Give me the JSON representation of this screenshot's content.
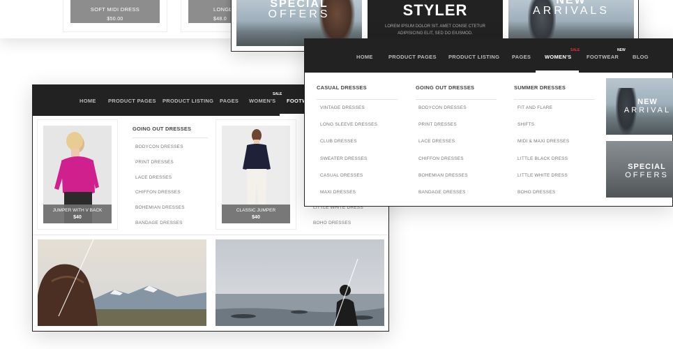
{
  "top_left": {
    "tiles": [
      {
        "name": "SOFT MIDI DRESS",
        "price": "$50.00"
      },
      {
        "name": "LONGLIN",
        "price": "$48.0"
      }
    ]
  },
  "top_right": {
    "special": {
      "line1": "SPECIAL",
      "line2": "OFFERS"
    },
    "styler": {
      "title": "STYLER",
      "text": "LOREM IPSUM DOLOR SIT. AMET CONSE CTETUR ADIPISICING ELIT, SED DO EIUSMOD."
    },
    "arrivals": {
      "line1": "NEW",
      "line2": "ARRIVALS"
    }
  },
  "nav": {
    "items": [
      "HOME",
      "PRODUCT PAGES",
      "PRODUCT LISTING",
      "PAGES",
      "WOMEN'S",
      "FOOTWEAR",
      "BLOG"
    ],
    "left_footwear": "FOOTW",
    "sale_tag": "SALE",
    "new_tag": "NEW"
  },
  "left_screen": {
    "products": [
      {
        "name": "JUMPER WITH V BACK",
        "price": "$40"
      },
      {
        "name": "CLASSIC JUMPER",
        "price": "$40"
      }
    ],
    "column": {
      "heading": "GOING OUT DRESSES",
      "links": [
        "BODYCON DRESSES",
        "PRINT DRESSES",
        "LACE DRESSES",
        "CHIFFON DRESSES",
        "BOHEMIAN DRESSES",
        "BANDAGE DRESSES"
      ]
    },
    "peek_links": [
      "LITTLE WHITE DRESS",
      "BOHO DRESSES"
    ]
  },
  "dropdown": {
    "columns": [
      {
        "heading": "CASUAL DRESSES",
        "links": [
          "VINTAGE DRESSES",
          "LONG SLEEVE DRESSES",
          "CLUB DRESSES",
          "SWEATER DRESSES",
          "CASUAL DRESSES",
          "MAXI DRESSES"
        ]
      },
      {
        "heading": "GOING OUT DRESSES",
        "links": [
          "BODYCON DRESSES",
          "PRINT DRESSES",
          "LACE DRESSES",
          "CHIFFON DRESSES",
          "BOHEMIAN DRESSES",
          "BANDAGE DRESSES"
        ]
      },
      {
        "heading": "SUMMER DRESSES",
        "links": [
          "FIT AND FLARE",
          "SHIFTS",
          "MIDI & MAXI DRESSES",
          "LITTLE BLACK DRESS",
          "LITTLE WHITE DRESS",
          "BOHO DRESSES"
        ]
      }
    ],
    "arrivals": {
      "line1": "NEW",
      "line2": "ARRIVAL"
    },
    "special": {
      "line1": "SPECIAL",
      "line2": "OFFERS"
    }
  },
  "colors": {
    "nav_bg": "#222222",
    "sale": "#e5322d",
    "label_bg": "#8d8d8d"
  }
}
